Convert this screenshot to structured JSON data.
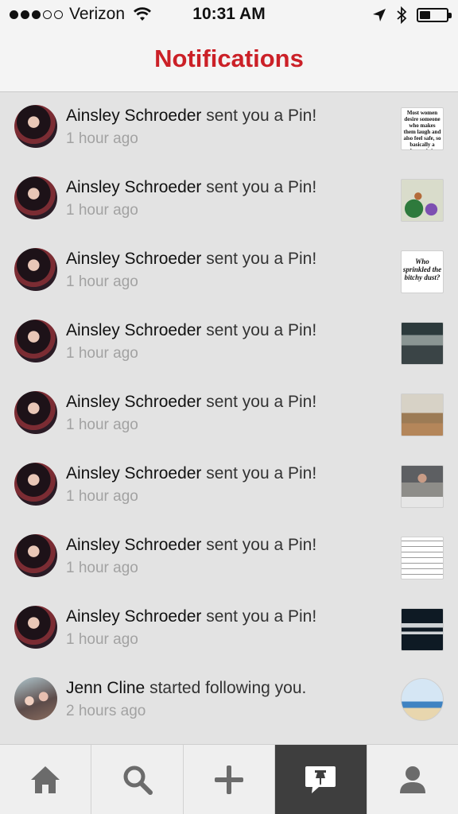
{
  "status_bar": {
    "carrier": "Verizon",
    "time": "10:31 AM",
    "signal_bars": 3,
    "signal_total": 5,
    "battery_level": 0.4
  },
  "nav": {
    "title": "Notifications"
  },
  "notifications": [
    {
      "name": "Ainsley Schroeder",
      "action": " sent you a Pin!",
      "time": "1 hour ago",
      "thumb_text": "Most women desire someone who makes them laugh and also feel safe, so basically a clown ninja."
    },
    {
      "name": "Ainsley Schroeder",
      "action": " sent you a Pin!",
      "time": "1 hour ago"
    },
    {
      "name": "Ainsley Schroeder",
      "action": " sent you a Pin!",
      "time": "1 hour ago",
      "thumb_text": "Who sprinkled the bitchy dust?"
    },
    {
      "name": "Ainsley Schroeder",
      "action": " sent you a Pin!",
      "time": "1 hour ago"
    },
    {
      "name": "Ainsley Schroeder",
      "action": " sent you a Pin!",
      "time": "1 hour ago"
    },
    {
      "name": "Ainsley Schroeder",
      "action": " sent you a Pin!",
      "time": "1 hour ago"
    },
    {
      "name": "Ainsley Schroeder",
      "action": " sent you a Pin!",
      "time": "1 hour ago"
    },
    {
      "name": "Ainsley Schroeder",
      "action": " sent you a Pin!",
      "time": "1 hour ago"
    },
    {
      "name": "Jenn Cline",
      "action": " started following you.",
      "time": "2 hours ago"
    }
  ],
  "tabs": [
    {
      "icon": "home-icon"
    },
    {
      "icon": "search-icon"
    },
    {
      "icon": "add-icon"
    },
    {
      "icon": "notifications-icon",
      "active": true
    },
    {
      "icon": "profile-icon"
    }
  ],
  "colors": {
    "brand_red": "#cb2027",
    "active_tab": "#3e3e3e",
    "tab_icon": "#6b6b6b",
    "list_background": "#e3e3e3"
  }
}
